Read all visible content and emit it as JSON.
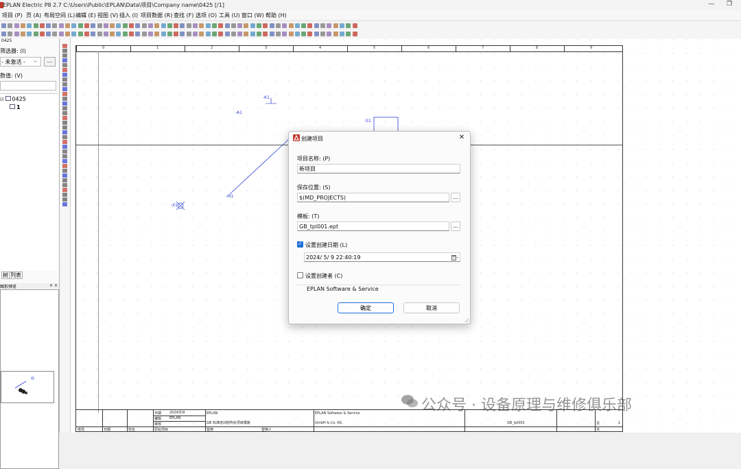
{
  "window": {
    "title": "EPLAN Electric P8 2.7   C:\\Users\\Public\\EPLAN\\Data\\项目\\Company name\\0425   [/1]",
    "minimize": "—",
    "restore": "❐"
  },
  "menu": {
    "items": [
      "项目 (P)",
      "页 (A)",
      "布局空间 (L)",
      "编辑 (E)",
      "视图 (V)",
      "插入 (I)",
      "项目数据 (R)",
      "查找 (F)",
      "选项 (O)",
      "工具 (U)",
      "窗口 (W)",
      "帮助 (H)"
    ]
  },
  "left_panel": {
    "header": "0425",
    "filter_label": "筛选器: (I)",
    "filter_value": "- 未激活 -",
    "filter_button": "...",
    "value_label": "数值: (V)",
    "tree_root": "0425",
    "tree_child": "1",
    "tabs": [
      "树",
      "列表"
    ],
    "preview_title": "图形预览"
  },
  "canvas": {
    "ruler_numbers": [
      "0",
      "1",
      "2",
      "3",
      "4",
      "5",
      "6",
      "7",
      "8",
      "9"
    ],
    "labels": {
      "k1": "-K1",
      "a1": "-A1",
      "x1": "-X1",
      "m1": "-M1",
      "s1": "-S1"
    },
    "titleblock": {
      "date_label": "日期",
      "date_value": "2024/5/9",
      "editor_label": "编辑",
      "editor_value": "EPLAN",
      "check_label": "审核",
      "original_label": "原始项目",
      "company1": "EPLAN",
      "desc": "GB 标准培训结构化项目模板",
      "company2": "EPLAN Software & Service",
      "company3": "GmbH & Co. KG",
      "drawing": "GB_tpl001",
      "page_label": "页",
      "page_value": "1",
      "of_label": "共",
      "status_cols": [
        "修改",
        "日期",
        "姓名"
      ],
      "replaced_by": "替换人",
      "replace_of": "替换"
    }
  },
  "dialog": {
    "title": "创建项目",
    "project_name_label": "项目名称: (P)",
    "project_name_value": "新项目",
    "location_label": "保存位置: (S)",
    "location_value": "$(MD_PROJECTS)",
    "browse1": "...",
    "template_label": "模板: (T)",
    "template_value": "GB_tpl001.ept",
    "browse2": "...",
    "set_date_label": "设置创建日期 (L)",
    "set_date_checked": true,
    "date_value": "2024/  5/  9 22:40:19",
    "set_creator_label": "设置创建者 (C)",
    "set_creator_checked": false,
    "creator_value": "EPLAN Software & Service",
    "ok": "确定",
    "cancel": "取消"
  },
  "watermark": {
    "text": "公众号 · 设备原理与维修俱乐部"
  },
  "colors": {
    "accent": "#1d6fd8",
    "eplan_red": "#c0392b",
    "schematic_blue": "#2b3fd1"
  }
}
